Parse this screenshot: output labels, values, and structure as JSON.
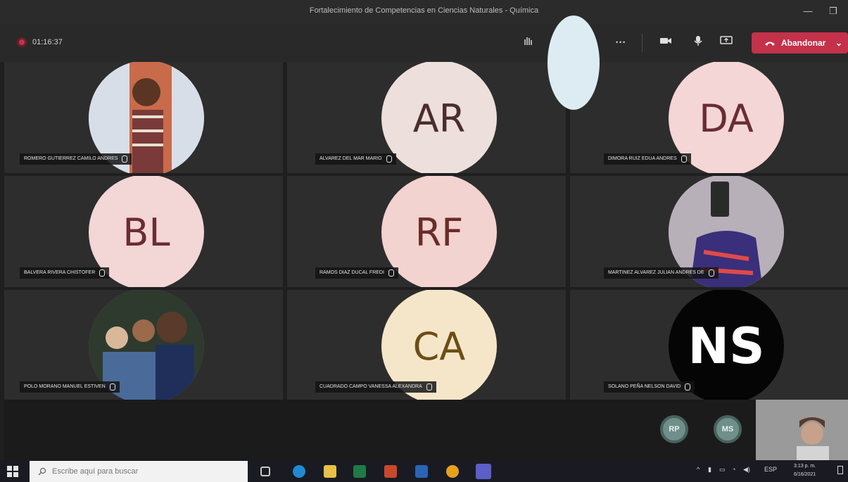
{
  "window": {
    "title": "Fortalecimiento de Competencias en Ciencias Naturales - Química",
    "minimize": "—",
    "restore": "❐"
  },
  "toolbar": {
    "timer": "01:16:37",
    "more": "···",
    "leave_label": "Abandonar",
    "leave_arrow": "⌄"
  },
  "participants": [
    {
      "name": "ROMERO GUTIERREZ CAMILO ANDRES",
      "initials": "",
      "type": "photo",
      "bg": "#cfd8e3"
    },
    {
      "name": "ALVAREZ DEL MAR MARIO",
      "initials": "AR",
      "type": "initials",
      "bg": "#eddfdb",
      "fg": "#4b2d2d"
    },
    {
      "name": "DIMORA RUIZ EDUA ANDRES",
      "initials": "DA",
      "type": "initials",
      "bg": "#f4d6d6",
      "fg": "#6a2c35"
    },
    {
      "name": "BALVERA RIVERA CHISTOFER",
      "initials": "BL",
      "type": "initials",
      "bg": "#f3d6d6",
      "fg": "#6a2c35"
    },
    {
      "name": "RAMOS DIAZ DUCAL FREDI",
      "initials": "RF",
      "type": "initials",
      "bg": "#f2d3cf",
      "fg": "#6a2c28"
    },
    {
      "name": "MARTINEZ ALVAREZ JULIAN ANDRES DE",
      "initials": "",
      "type": "photo",
      "bg": "#c9c2cf"
    },
    {
      "name": "POLO MORANO MANUEL ESTIVEN",
      "initials": "",
      "type": "photo",
      "bg": "#6b6f63"
    },
    {
      "name": "CUADRADO CAMPO VANESSA ALEXANDRA",
      "initials": "CA",
      "type": "initials",
      "bg": "#f6e6c9",
      "fg": "#6b4e16"
    },
    {
      "name": "SOLANO PEÑA NELSON DAVID",
      "initials": "NS",
      "type": "logo",
      "bg": "#050505",
      "fg": "#ffffff"
    }
  ],
  "mini_avatars": [
    "RP",
    "MS"
  ],
  "taskbar": {
    "search_placeholder": "Escribe aquí para buscar",
    "lang": "ESP",
    "time": "3:13 p. m.",
    "date": "6/16/2021"
  },
  "colors": {
    "leave": "#c4314b",
    "tile": "#2d2d2d",
    "background": "#1f1f1f"
  }
}
